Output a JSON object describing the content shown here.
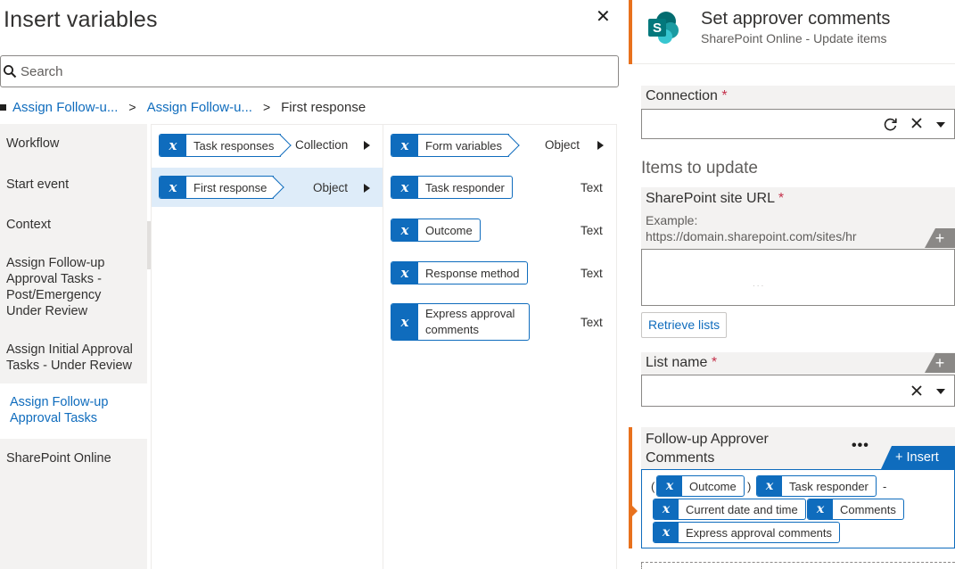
{
  "insert_variables": {
    "title": "Insert variables",
    "close_glyph": "✕",
    "search_placeholder": "Search",
    "breadcrumb": {
      "items": [
        "Assign Follow-u...",
        "Assign Follow-u..."
      ],
      "separator": ">",
      "current": "First response"
    },
    "nav": [
      "Workflow",
      "Start event",
      "Context",
      "Assign Follow-up Approval Tasks - Post/Emergency Under Review",
      "Assign Initial Approval Tasks - Under Review",
      "Assign Follow-up Approval Tasks",
      "SharePoint Online"
    ],
    "column2": [
      {
        "name": "Task responses",
        "type": "Collection"
      },
      {
        "name": "First response",
        "type": "Object"
      }
    ],
    "column3": [
      {
        "name": "Form variables",
        "type": "Object"
      },
      {
        "name": "Task responder",
        "type": "Text"
      },
      {
        "name": "Outcome",
        "type": "Text"
      },
      {
        "name": "Response method",
        "type": "Text"
      },
      {
        "name": "Express approval comments",
        "type": "Text"
      }
    ],
    "variable_badge": "x"
  },
  "action": {
    "title": "Set approver comments",
    "subtitle": "SharePoint Online - Update items",
    "logo_letter": "S",
    "connection": {
      "label": "Connection",
      "required": "*"
    },
    "section_title": "Items to update",
    "site_url": {
      "label": "SharePoint site URL",
      "required": "*",
      "example_label": "Example:",
      "example_value": "https://domain.sharepoint.com/sites/hr",
      "faint_value": "..."
    },
    "plus": "+",
    "retrieve_button": "Retrieve lists",
    "list_name": {
      "label": "List name",
      "required": "*"
    },
    "follow_up": {
      "label_line1": "Follow-up Approver",
      "label_line2": "Comments",
      "more": "•••",
      "insert_button": "+ Insert",
      "open_paren": "(",
      "close_paren": ")",
      "dash": "-",
      "tokens": [
        "Outcome",
        "Task responder",
        "Current date and time",
        "Comments",
        "Express approval comments"
      ]
    }
  },
  "colors": {
    "accent_blue": "#0f6cbd",
    "accent_orange": "#e8711d",
    "sharepoint_teal": "#03787c"
  }
}
